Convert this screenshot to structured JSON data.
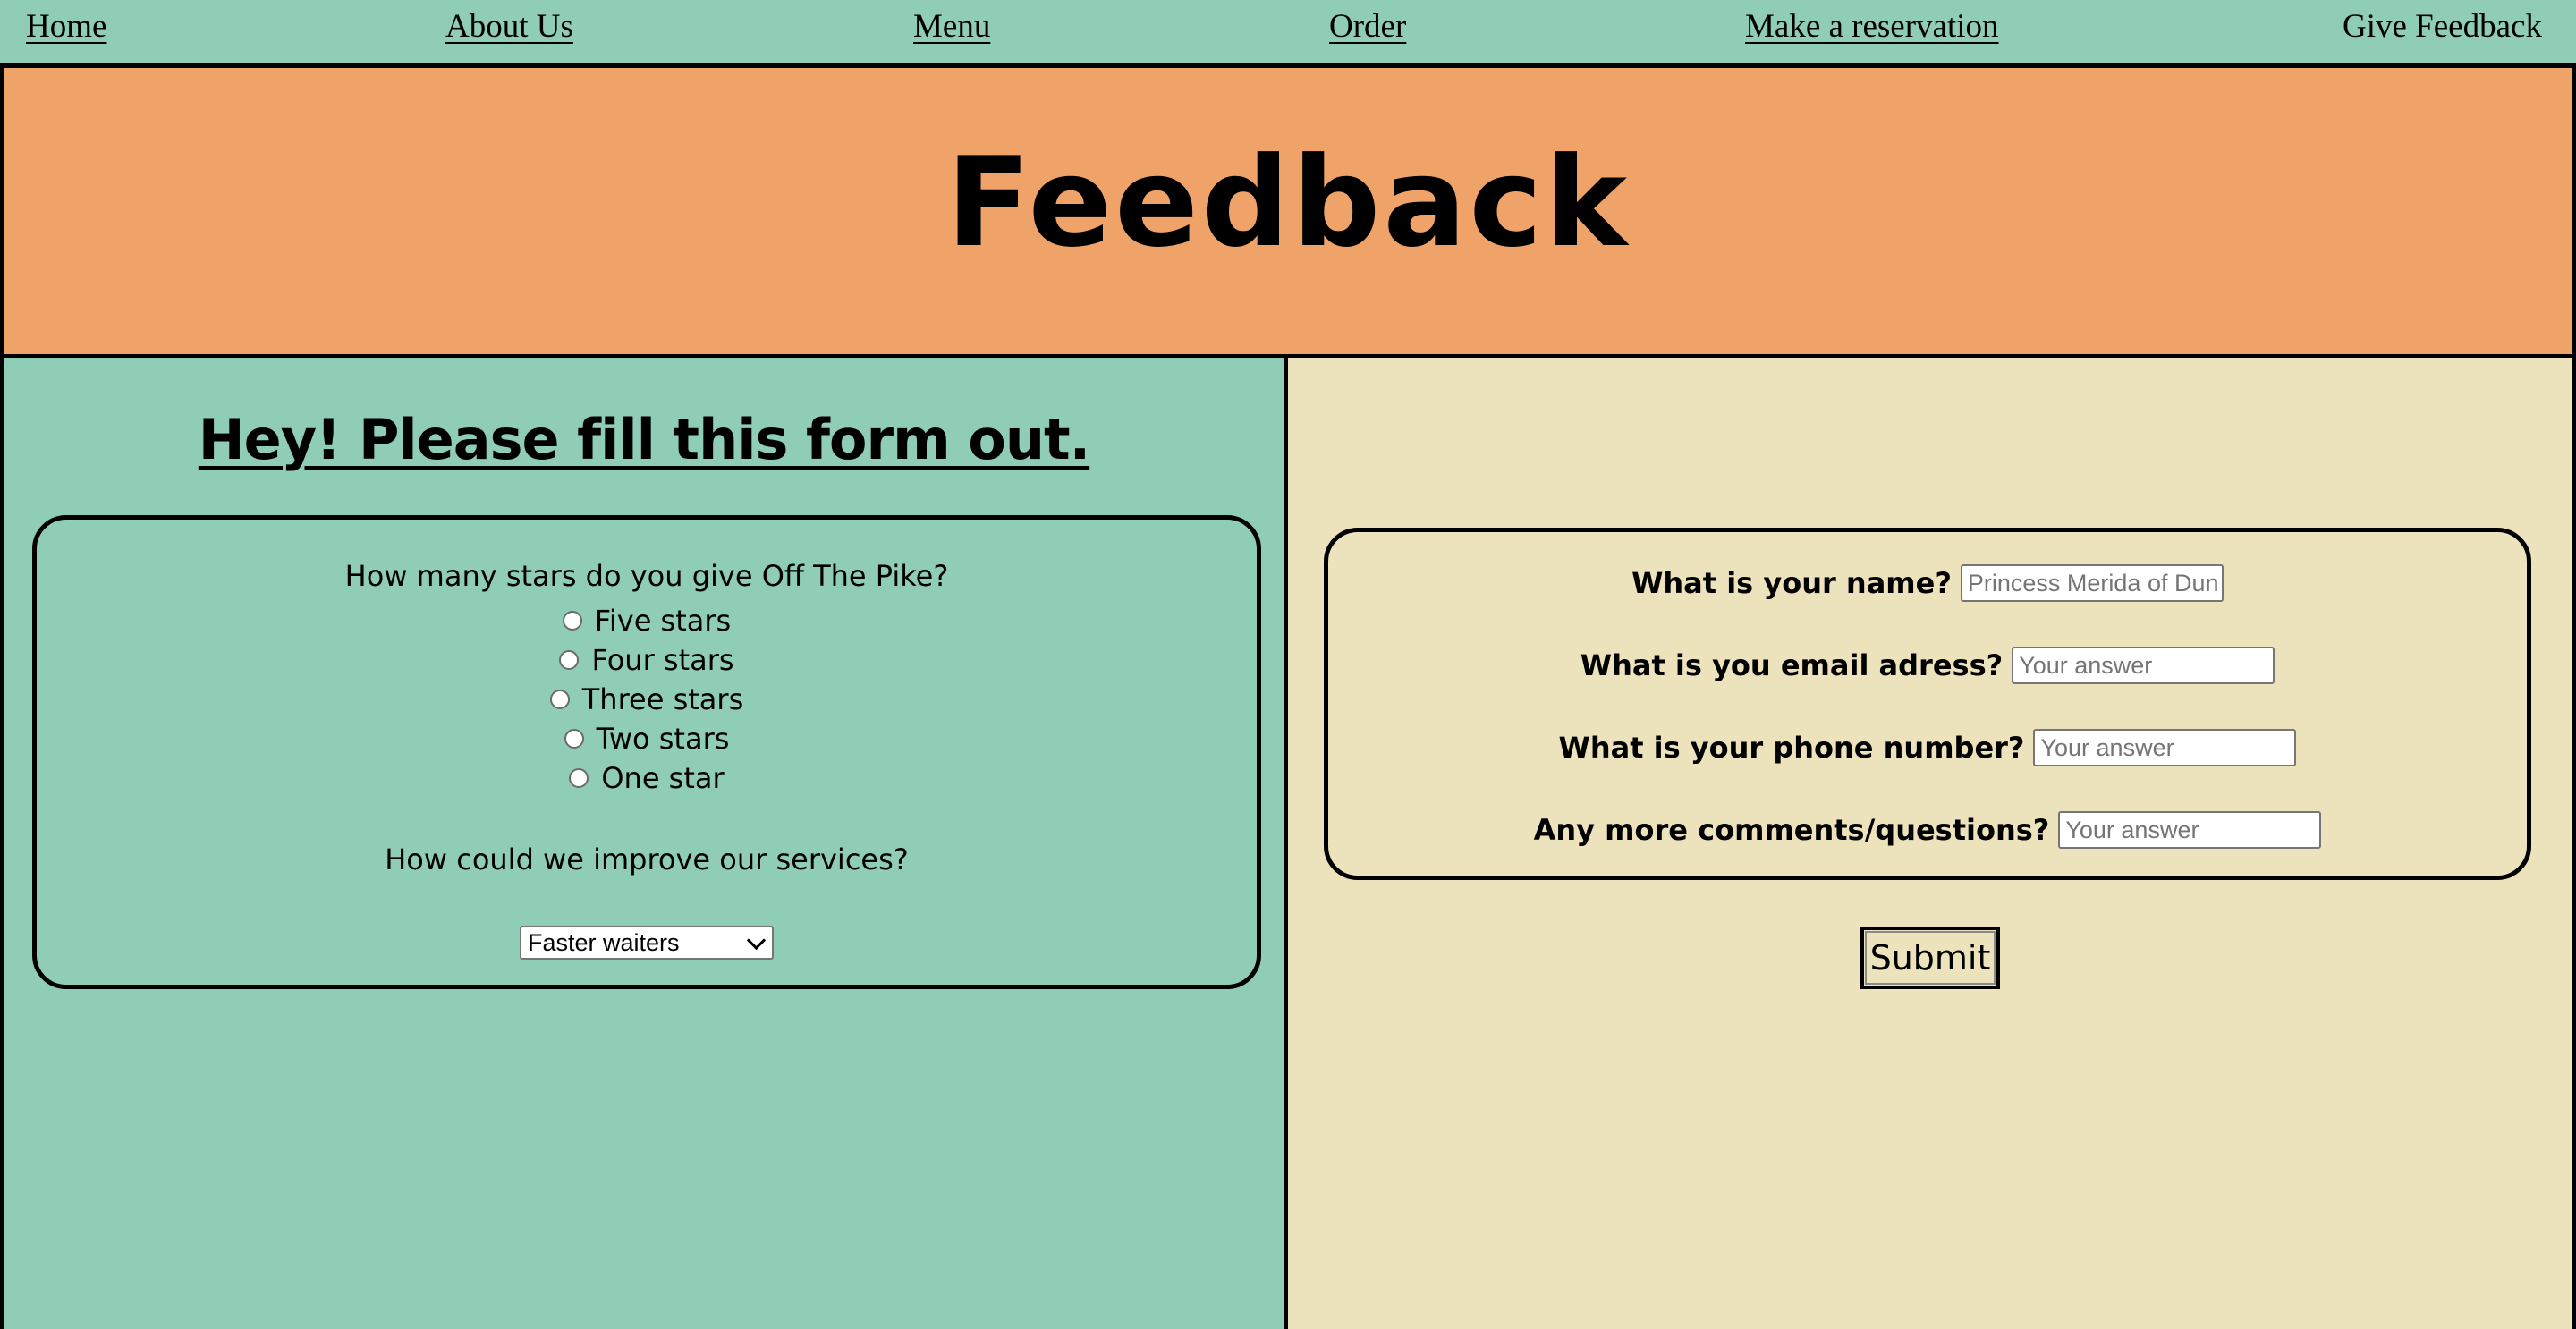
{
  "nav": {
    "items": [
      {
        "label": "Home"
      },
      {
        "label": "About Us"
      },
      {
        "label": "Menu"
      },
      {
        "label": "Order"
      },
      {
        "label": "Make a reservation"
      },
      {
        "label": "Give Feedback"
      }
    ]
  },
  "header": {
    "title": "Feedback"
  },
  "left": {
    "title": "Hey! Please fill this form out.",
    "stars_question": "How many stars do you give Off The Pike?",
    "star_options": [
      "Five stars",
      "Four stars",
      "Three stars",
      "Two stars",
      "One star"
    ],
    "improve_question": "How could we improve our services?",
    "improve_selected": "Faster waiters"
  },
  "right": {
    "fields": [
      {
        "label": "What is your name?",
        "placeholder": "Princess Merida of Dun"
      },
      {
        "label": "What is you email adress?",
        "placeholder": "Your answer"
      },
      {
        "label": "What is your phone number?",
        "placeholder": "Your answer"
      },
      {
        "label": "Any more comments/questions?",
        "placeholder": "Your answer"
      }
    ],
    "submit_label": "Submit"
  },
  "colors": {
    "teal": "#8fcdb6",
    "orange": "#f0a368",
    "cream": "#ece3bd"
  }
}
